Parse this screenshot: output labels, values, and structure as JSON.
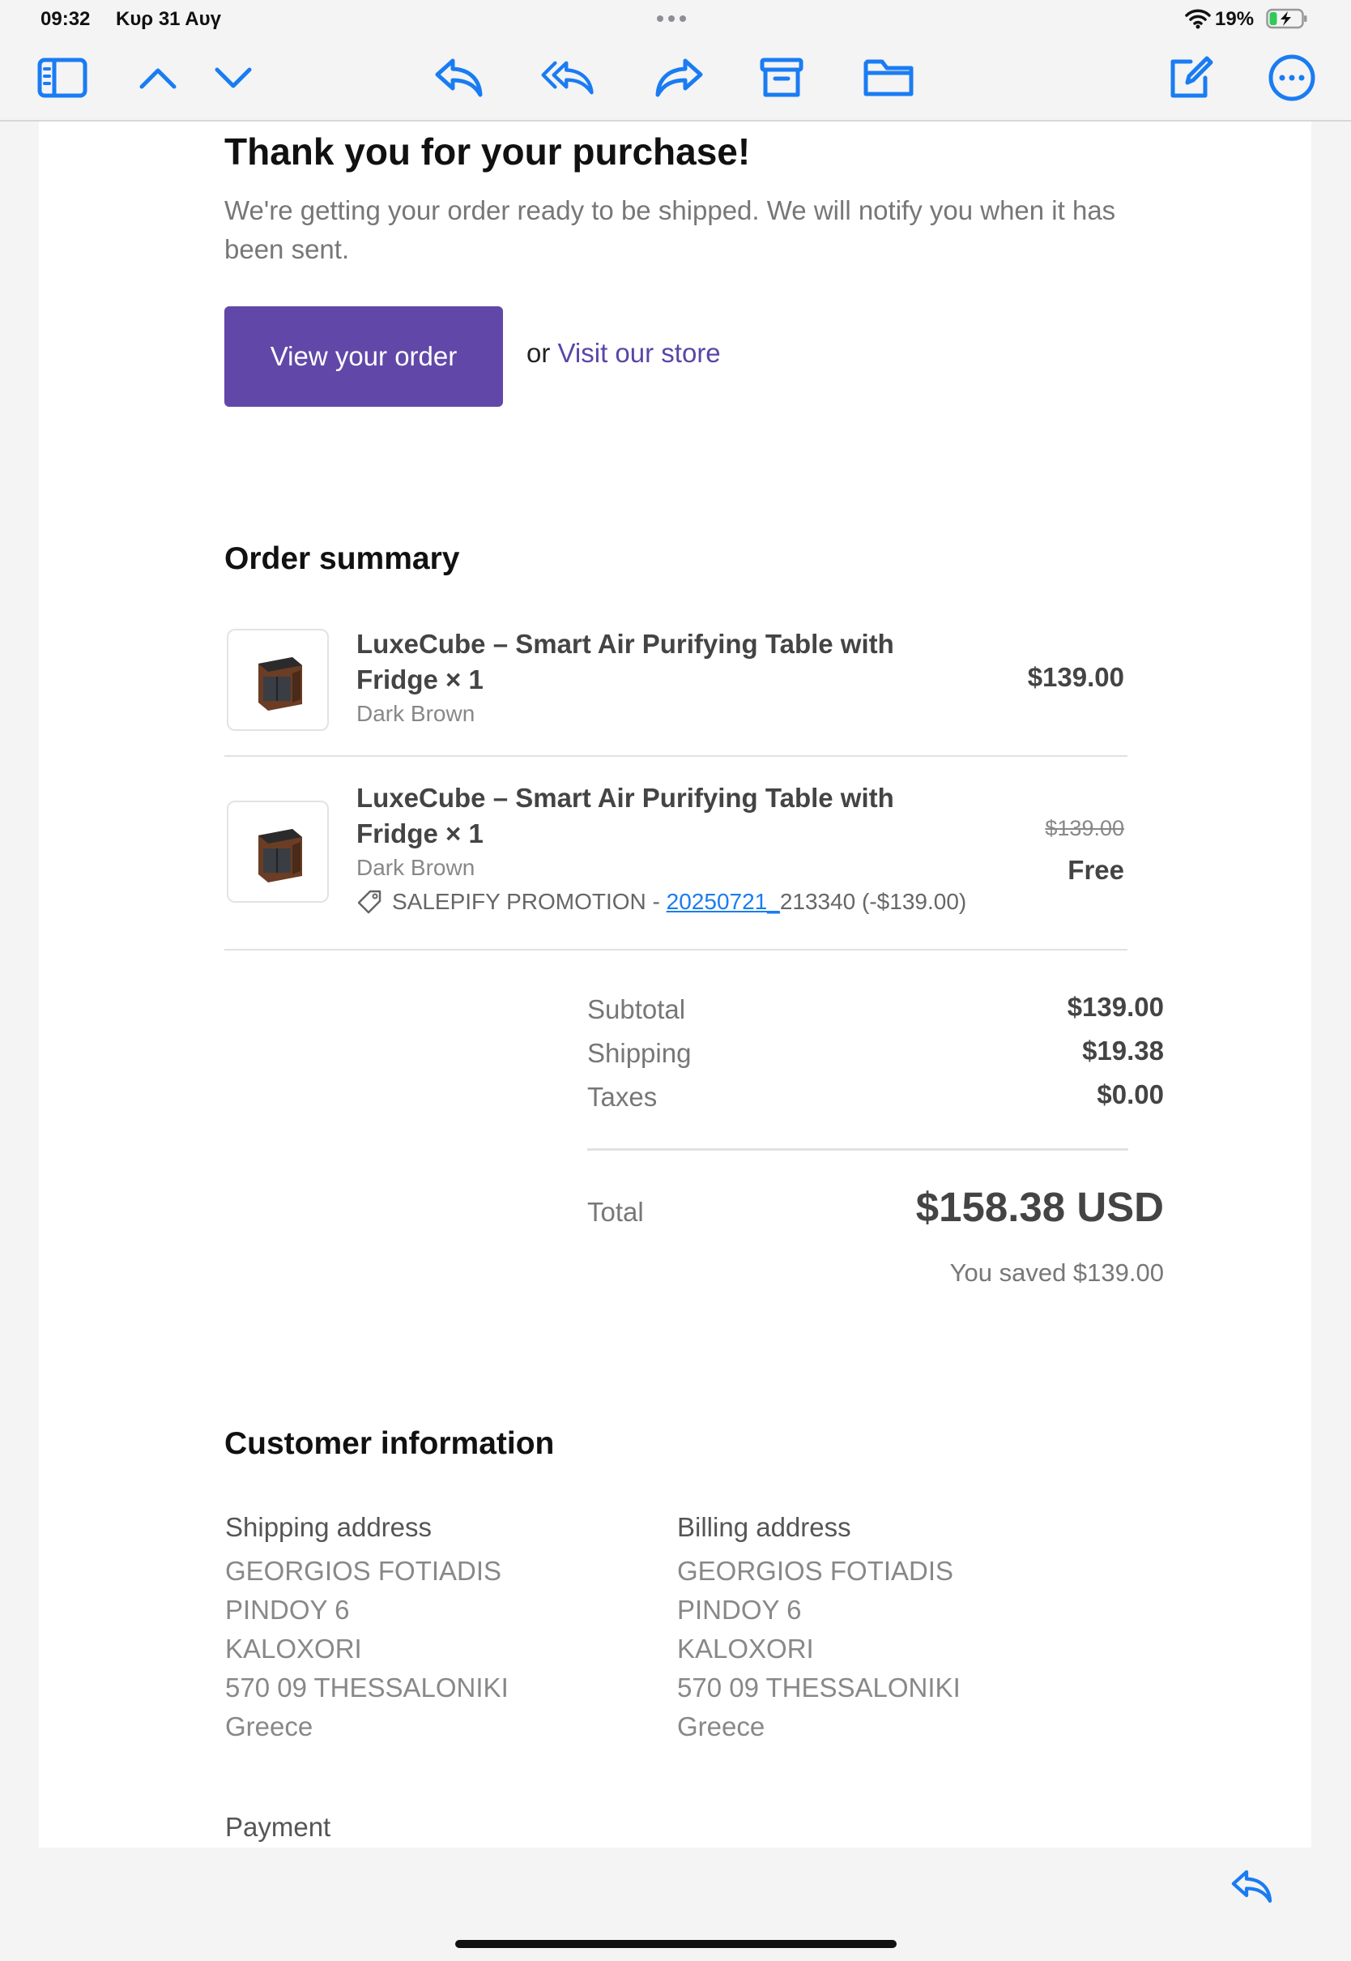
{
  "status_bar": {
    "time": "09:32",
    "date": "Κυρ 31 Αυγ",
    "battery": "19%"
  },
  "toolbar": {
    "icons": [
      "sidebar-icon",
      "chevron-up-icon",
      "chevron-down-icon",
      "reply-icon",
      "reply-all-icon",
      "forward-icon",
      "archive-icon",
      "folder-icon",
      "compose-icon",
      "more-icon"
    ],
    "accent": "#1a7cf2"
  },
  "email": {
    "heading": "Thank you for your purchase!",
    "lead": "We're getting your order ready to be shipped. We will notify you when it has been sent.",
    "view_order_button": "View your order",
    "or_text": "or ",
    "visit_store_link": "Visit our store",
    "button_color": "#6148a8",
    "order_summary_title": "Order summary",
    "items": [
      {
        "name": "LuxeCube – Smart Air Purifying Table with Fridge × 1",
        "variant": "Dark Brown",
        "price": "$139.00"
      },
      {
        "name": "LuxeCube – Smart Air Purifying Table with Fridge × 1",
        "variant": "Dark Brown",
        "original_price": "$139.00",
        "price": "Free",
        "promo_prefix": "SALEPIFY PROMOTION - ",
        "promo_link": "20250721_",
        "promo_suffix": "213340 (-$139.00)"
      }
    ],
    "totals": {
      "subtotal_label": "Subtotal",
      "subtotal": "$139.00",
      "shipping_label": "Shipping",
      "shipping": "$19.38",
      "taxes_label": "Taxes",
      "taxes": "$0.00",
      "total_label": "Total",
      "total": "$158.38 USD",
      "saved": "You saved $139.00"
    },
    "customer_info_title": "Customer information",
    "shipping_address": {
      "title": "Shipping address",
      "lines": [
        "GEORGIOS FOTIADIS",
        "PINDOY 6",
        "KALOXORI",
        "570 09 THESSALONIKI",
        "Greece"
      ]
    },
    "billing_address": {
      "title": "Billing address",
      "lines": [
        "GEORGIOS FOTIADIS",
        "PINDOY 6",
        "KALOXORI",
        "570 09 THESSALONIKI",
        "Greece"
      ]
    },
    "payment_title": "Payment"
  }
}
